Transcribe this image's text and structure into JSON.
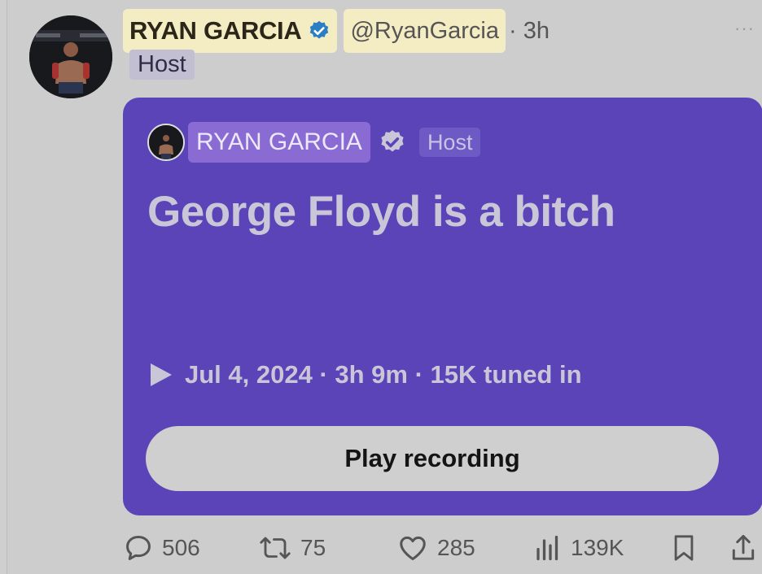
{
  "tweet": {
    "display_name": "RYAN GARCIA",
    "handle": "@RyanGarcia",
    "time": "· 3h",
    "role_badge": "Host",
    "more_label": "···"
  },
  "space_card": {
    "host_name": "RYAN GARCIA",
    "host_badge": "Host",
    "title": "George Floyd is a bitch",
    "meta": "Jul 4, 2024 · 3h 9m · 15K tuned in",
    "play_button_label": "Play recording",
    "background_color": "#5b44b8"
  },
  "actions": {
    "replies": "506",
    "reposts": "75",
    "likes": "285",
    "views": "139K"
  },
  "icons": {
    "verified": "verified-badge-icon",
    "play": "play-triangle-icon",
    "reply": "reply-bubble-icon",
    "repost": "repost-arrows-icon",
    "like": "heart-icon",
    "views": "views-bar-icon",
    "bookmark": "bookmark-icon",
    "share": "share-icon"
  },
  "colors": {
    "highlight_yellow": "#f4ecc3",
    "verified_blue": "#1d9bf0",
    "card_purple": "#5b44b8"
  }
}
